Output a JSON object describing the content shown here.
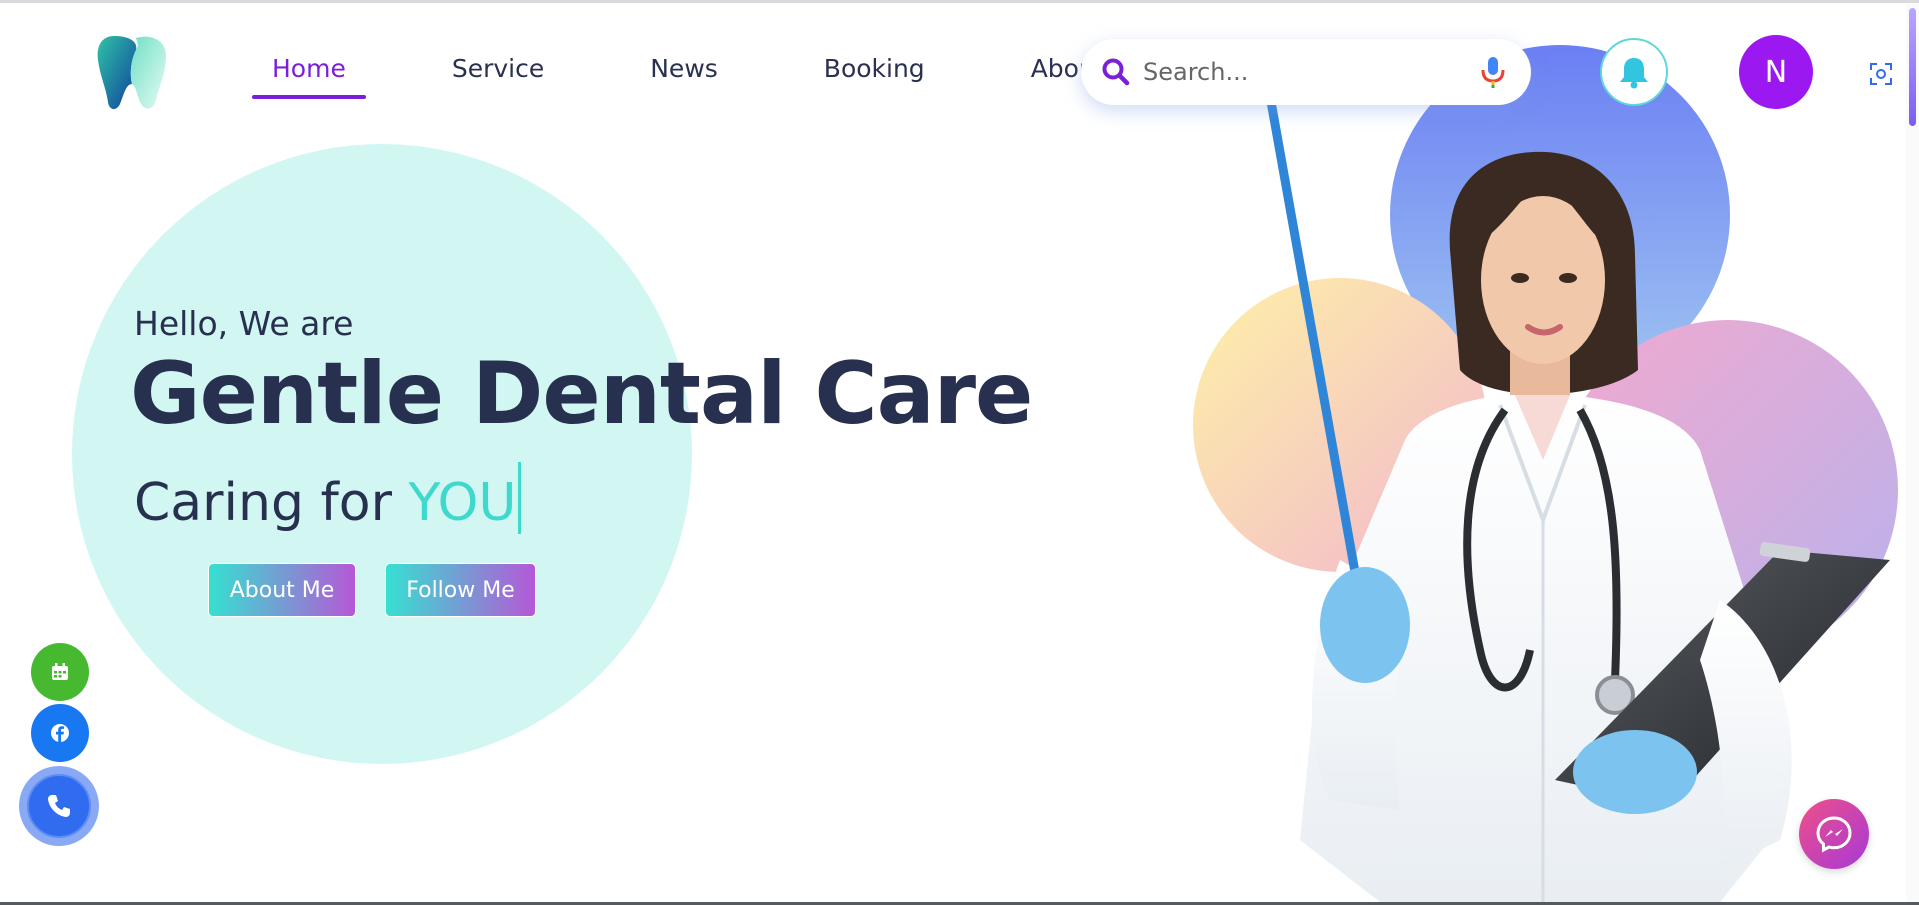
{
  "nav": {
    "items": [
      {
        "label": "Home",
        "active": true
      },
      {
        "label": "Service",
        "active": false
      },
      {
        "label": "News",
        "active": false
      },
      {
        "label": "Booking",
        "active": false
      },
      {
        "label": "About us",
        "active": false
      }
    ]
  },
  "search": {
    "placeholder": "Search..."
  },
  "avatar": {
    "initial": "N"
  },
  "hero": {
    "greeting": "Hello, We are",
    "title": "Gentle Dental Care",
    "tagline_prefix": "Caring for ",
    "tagline_typed": "YOU",
    "buttons": {
      "about": "About Me",
      "follow": "Follow Me"
    }
  },
  "colors": {
    "accent": "#7b1fd9",
    "heading": "#27304f",
    "mint": "#d2f7f3",
    "teal": "#3fd8cc",
    "avatar_bg": "#9b18f0"
  },
  "icons": {
    "logo": "tooth-logo",
    "search": "search-icon",
    "mic": "mic-icon",
    "bell": "bell-icon",
    "capture": "screen-capture-icon",
    "calendar": "calendar-icon",
    "facebook": "facebook-icon",
    "phone": "phone-icon",
    "messenger": "messenger-icon"
  }
}
